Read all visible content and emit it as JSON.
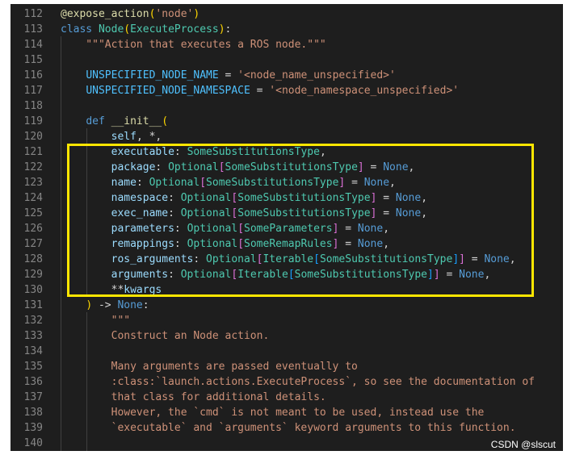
{
  "colors": {
    "background": "#1e1e1e",
    "line_number": "#858585",
    "keyword": "#569cd6",
    "class": "#4ec9b0",
    "function": "#dcdcaa",
    "string": "#ce9178",
    "parameter": "#9cdcfe",
    "constant": "#4fc1ff",
    "highlight_box": "#ffe600"
  },
  "watermark": "CSDN @slscut",
  "lines": [
    {
      "num": "112",
      "tokens": [
        {
          "t": "@expose_action",
          "c": "func"
        },
        {
          "t": "(",
          "c": "bracket1"
        },
        {
          "t": "'node'",
          "c": "string"
        },
        {
          "t": ")",
          "c": "bracket1"
        }
      ]
    },
    {
      "num": "113",
      "tokens": [
        {
          "t": "class ",
          "c": "keyword"
        },
        {
          "t": "Node",
          "c": "class"
        },
        {
          "t": "(",
          "c": "bracket1"
        },
        {
          "t": "ExecuteProcess",
          "c": "class"
        },
        {
          "t": ")",
          "c": "bracket1"
        },
        {
          "t": ":",
          "c": "plain"
        }
      ]
    },
    {
      "num": "114",
      "tokens": [
        {
          "t": "    \"\"\"Action that executes a ROS node.\"\"\"",
          "c": "string"
        }
      ]
    },
    {
      "num": "115",
      "tokens": []
    },
    {
      "num": "116",
      "tokens": [
        {
          "t": "    ",
          "c": "plain"
        },
        {
          "t": "UNSPECIFIED_NODE_NAME",
          "c": "const"
        },
        {
          "t": " = ",
          "c": "plain"
        },
        {
          "t": "'<node_name_unspecified>'",
          "c": "string"
        }
      ]
    },
    {
      "num": "117",
      "tokens": [
        {
          "t": "    ",
          "c": "plain"
        },
        {
          "t": "UNSPECIFIED_NODE_NAMESPACE",
          "c": "const"
        },
        {
          "t": " = ",
          "c": "plain"
        },
        {
          "t": "'<node_namespace_unspecified>'",
          "c": "string"
        }
      ]
    },
    {
      "num": "118",
      "tokens": []
    },
    {
      "num": "119",
      "tokens": [
        {
          "t": "    ",
          "c": "plain"
        },
        {
          "t": "def ",
          "c": "keyword"
        },
        {
          "t": "__init__",
          "c": "func"
        },
        {
          "t": "(",
          "c": "bracket1"
        }
      ]
    },
    {
      "num": "120",
      "tokens": [
        {
          "t": "        ",
          "c": "plain"
        },
        {
          "t": "self",
          "c": "param"
        },
        {
          "t": ", *,",
          "c": "plain"
        }
      ]
    },
    {
      "num": "121",
      "tokens": [
        {
          "t": "        ",
          "c": "plain"
        },
        {
          "t": "executable",
          "c": "param"
        },
        {
          "t": ": ",
          "c": "plain"
        },
        {
          "t": "SomeSubstitutionsType",
          "c": "class"
        },
        {
          "t": ",",
          "c": "plain"
        }
      ]
    },
    {
      "num": "122",
      "tokens": [
        {
          "t": "        ",
          "c": "plain"
        },
        {
          "t": "package",
          "c": "param"
        },
        {
          "t": ": ",
          "c": "plain"
        },
        {
          "t": "Optional",
          "c": "class"
        },
        {
          "t": "[",
          "c": "bracket2"
        },
        {
          "t": "SomeSubstitutionsType",
          "c": "class"
        },
        {
          "t": "]",
          "c": "bracket2"
        },
        {
          "t": " = ",
          "c": "plain"
        },
        {
          "t": "None",
          "c": "keyword"
        },
        {
          "t": ",",
          "c": "plain"
        }
      ]
    },
    {
      "num": "123",
      "tokens": [
        {
          "t": "        ",
          "c": "plain"
        },
        {
          "t": "name",
          "c": "param"
        },
        {
          "t": ": ",
          "c": "plain"
        },
        {
          "t": "Optional",
          "c": "class"
        },
        {
          "t": "[",
          "c": "bracket2"
        },
        {
          "t": "SomeSubstitutionsType",
          "c": "class"
        },
        {
          "t": "]",
          "c": "bracket2"
        },
        {
          "t": " = ",
          "c": "plain"
        },
        {
          "t": "None",
          "c": "keyword"
        },
        {
          "t": ",",
          "c": "plain"
        }
      ]
    },
    {
      "num": "124",
      "tokens": [
        {
          "t": "        ",
          "c": "plain"
        },
        {
          "t": "namespace",
          "c": "param"
        },
        {
          "t": ": ",
          "c": "plain"
        },
        {
          "t": "Optional",
          "c": "class"
        },
        {
          "t": "[",
          "c": "bracket2"
        },
        {
          "t": "SomeSubstitutionsType",
          "c": "class"
        },
        {
          "t": "]",
          "c": "bracket2"
        },
        {
          "t": " = ",
          "c": "plain"
        },
        {
          "t": "None",
          "c": "keyword"
        },
        {
          "t": ",",
          "c": "plain"
        }
      ]
    },
    {
      "num": "125",
      "tokens": [
        {
          "t": "        ",
          "c": "plain"
        },
        {
          "t": "exec_name",
          "c": "param"
        },
        {
          "t": ": ",
          "c": "plain"
        },
        {
          "t": "Optional",
          "c": "class"
        },
        {
          "t": "[",
          "c": "bracket2"
        },
        {
          "t": "SomeSubstitutionsType",
          "c": "class"
        },
        {
          "t": "]",
          "c": "bracket2"
        },
        {
          "t": " = ",
          "c": "plain"
        },
        {
          "t": "None",
          "c": "keyword"
        },
        {
          "t": ",",
          "c": "plain"
        }
      ]
    },
    {
      "num": "126",
      "tokens": [
        {
          "t": "        ",
          "c": "plain"
        },
        {
          "t": "parameters",
          "c": "param"
        },
        {
          "t": ": ",
          "c": "plain"
        },
        {
          "t": "Optional",
          "c": "class"
        },
        {
          "t": "[",
          "c": "bracket2"
        },
        {
          "t": "SomeParameters",
          "c": "class"
        },
        {
          "t": "]",
          "c": "bracket2"
        },
        {
          "t": " = ",
          "c": "plain"
        },
        {
          "t": "None",
          "c": "keyword"
        },
        {
          "t": ",",
          "c": "plain"
        }
      ]
    },
    {
      "num": "127",
      "tokens": [
        {
          "t": "        ",
          "c": "plain"
        },
        {
          "t": "remappings",
          "c": "param"
        },
        {
          "t": ": ",
          "c": "plain"
        },
        {
          "t": "Optional",
          "c": "class"
        },
        {
          "t": "[",
          "c": "bracket2"
        },
        {
          "t": "SomeRemapRules",
          "c": "class"
        },
        {
          "t": "]",
          "c": "bracket2"
        },
        {
          "t": " = ",
          "c": "plain"
        },
        {
          "t": "None",
          "c": "keyword"
        },
        {
          "t": ",",
          "c": "plain"
        }
      ]
    },
    {
      "num": "128",
      "tokens": [
        {
          "t": "        ",
          "c": "plain"
        },
        {
          "t": "ros_arguments",
          "c": "param"
        },
        {
          "t": ": ",
          "c": "plain"
        },
        {
          "t": "Optional",
          "c": "class"
        },
        {
          "t": "[",
          "c": "bracket2"
        },
        {
          "t": "Iterable",
          "c": "class"
        },
        {
          "t": "[",
          "c": "bracket3"
        },
        {
          "t": "SomeSubstitutionsType",
          "c": "class"
        },
        {
          "t": "]",
          "c": "bracket3"
        },
        {
          "t": "]",
          "c": "bracket2"
        },
        {
          "t": " = ",
          "c": "plain"
        },
        {
          "t": "None",
          "c": "keyword"
        },
        {
          "t": ",",
          "c": "plain"
        }
      ]
    },
    {
      "num": "129",
      "tokens": [
        {
          "t": "        ",
          "c": "plain"
        },
        {
          "t": "arguments",
          "c": "param"
        },
        {
          "t": ": ",
          "c": "plain"
        },
        {
          "t": "Optional",
          "c": "class"
        },
        {
          "t": "[",
          "c": "bracket2"
        },
        {
          "t": "Iterable",
          "c": "class"
        },
        {
          "t": "[",
          "c": "bracket3"
        },
        {
          "t": "SomeSubstitutionsType",
          "c": "class"
        },
        {
          "t": "]",
          "c": "bracket3"
        },
        {
          "t": "]",
          "c": "bracket2"
        },
        {
          "t": " = ",
          "c": "plain"
        },
        {
          "t": "None",
          "c": "keyword"
        },
        {
          "t": ",",
          "c": "plain"
        }
      ]
    },
    {
      "num": "130",
      "tokens": [
        {
          "t": "        ",
          "c": "plain"
        },
        {
          "t": "**",
          "c": "plain"
        },
        {
          "t": "kwargs",
          "c": "param"
        }
      ]
    },
    {
      "num": "131",
      "tokens": [
        {
          "t": "    ",
          "c": "plain"
        },
        {
          "t": ")",
          "c": "bracket1"
        },
        {
          "t": " -> ",
          "c": "plain"
        },
        {
          "t": "None",
          "c": "keyword"
        },
        {
          "t": ":",
          "c": "plain"
        }
      ]
    },
    {
      "num": "132",
      "tokens": [
        {
          "t": "        \"\"\"",
          "c": "string"
        }
      ]
    },
    {
      "num": "133",
      "tokens": [
        {
          "t": "        Construct an Node action.",
          "c": "string"
        }
      ]
    },
    {
      "num": "134",
      "tokens": []
    },
    {
      "num": "135",
      "tokens": [
        {
          "t": "        Many arguments are passed eventually to",
          "c": "string"
        }
      ]
    },
    {
      "num": "136",
      "tokens": [
        {
          "t": "        :class:`launch.actions.ExecuteProcess`, so see the documentation of",
          "c": "string"
        }
      ]
    },
    {
      "num": "137",
      "tokens": [
        {
          "t": "        that class for additional details.",
          "c": "string"
        }
      ]
    },
    {
      "num": "138",
      "tokens": [
        {
          "t": "        However, the `cmd` is not meant to be used, instead use the",
          "c": "string"
        }
      ]
    },
    {
      "num": "139",
      "tokens": [
        {
          "t": "        `executable` and `arguments` keyword arguments to this function.",
          "c": "string"
        }
      ]
    },
    {
      "num": "140",
      "tokens": []
    }
  ]
}
